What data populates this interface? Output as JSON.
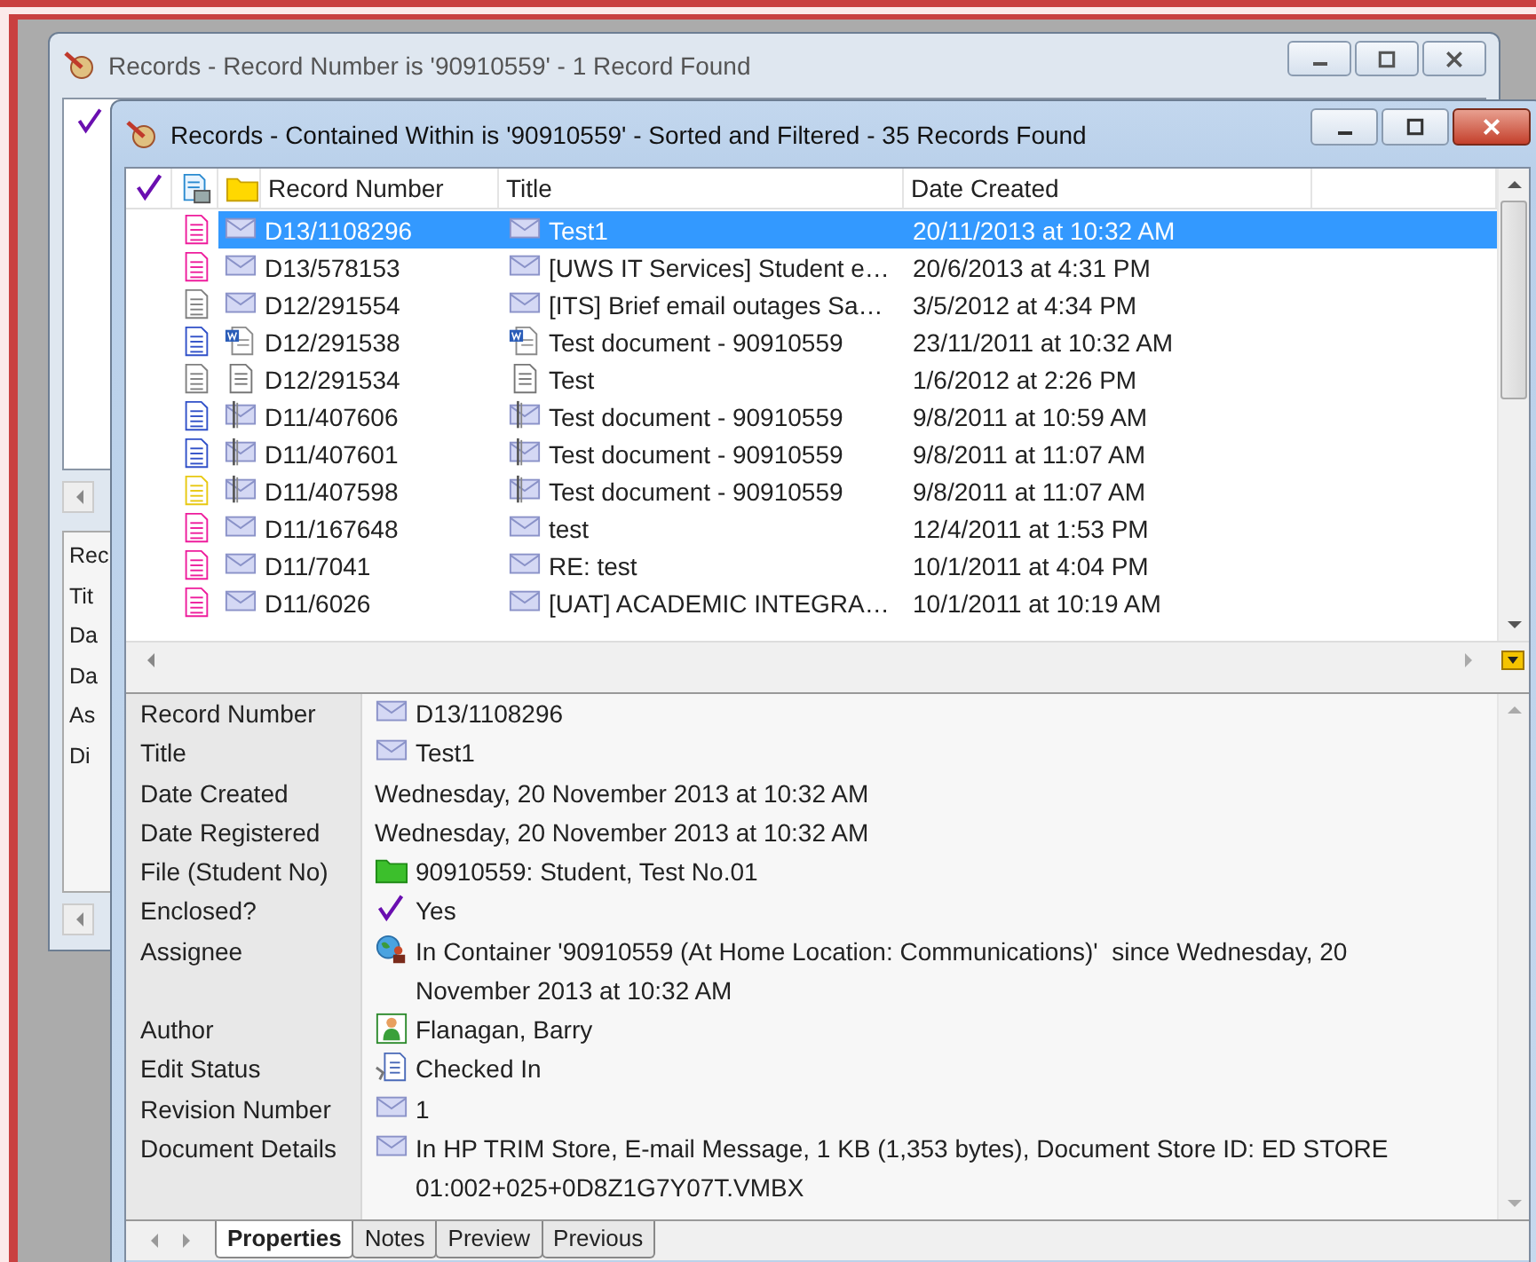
{
  "background_window": {
    "title": "Records - Record Number is '90910559' - 1 Record Found",
    "property_labels": [
      "Rec",
      "Tit",
      "Da",
      "Da",
      "As",
      "Di"
    ]
  },
  "window": {
    "title": "Records - Contained Within is '90910559' - Sorted and Filtered - 35 Records Found",
    "columns": [
      "Record Number",
      "Title",
      "Date Created"
    ],
    "rows": [
      {
        "color": "#ee1c9c",
        "kind": "email",
        "number": "D13/1108296",
        "title": "Test1",
        "date": "20/11/2013 at 10:32 AM",
        "selected": true
      },
      {
        "color": "#ee1c9c",
        "kind": "email",
        "number": "D13/578153",
        "title": "[UWS IT Services] Student e…",
        "date": "20/6/2013 at 4:31 PM",
        "selected": false
      },
      {
        "color": "#808080",
        "kind": "email",
        "number": "D12/291554",
        "title": "[ITS] Brief email outages Sa…",
        "date": "3/5/2012 at 4:34 PM",
        "selected": false
      },
      {
        "color": "#3050c8",
        "kind": "word",
        "number": "D12/291538",
        "title": "Test document - 90910559",
        "date": "23/11/2011 at 10:32 AM",
        "selected": false
      },
      {
        "color": "#808080",
        "kind": "text",
        "number": "D12/291534",
        "title": "Test",
        "date": "1/6/2012 at 2:26 PM",
        "selected": false
      },
      {
        "color": "#3050c8",
        "kind": "attachment",
        "number": "D11/407606",
        "title": "Test document - 90910559",
        "date": "9/8/2011 at 10:59 AM",
        "selected": false
      },
      {
        "color": "#3050c8",
        "kind": "attachment",
        "number": "D11/407601",
        "title": "Test document - 90910559",
        "date": "9/8/2011 at 11:07 AM",
        "selected": false
      },
      {
        "color": "#e8c810",
        "kind": "attachment",
        "number": "D11/407598",
        "title": "Test document - 90910559",
        "date": "9/8/2011 at 11:07 AM",
        "selected": false
      },
      {
        "color": "#ee1c9c",
        "kind": "email",
        "number": "D11/167648",
        "title": "test",
        "date": "12/4/2011 at 1:53 PM",
        "selected": false
      },
      {
        "color": "#ee1c9c",
        "kind": "email",
        "number": "D11/7041",
        "title": "RE: test",
        "date": "10/1/2011 at 4:04 PM",
        "selected": false
      },
      {
        "color": "#ee1c9c",
        "kind": "email",
        "number": "D11/6026",
        "title": "[UAT] ACADEMIC INTEGRA…",
        "date": "10/1/2011 at 10:19 AM",
        "selected": false
      }
    ],
    "properties": [
      {
        "label": "Record Number",
        "kind": "email",
        "lines": [
          "D13/1108296"
        ]
      },
      {
        "label": "Title",
        "kind": "email",
        "lines": [
          "Test1"
        ]
      },
      {
        "label": "Date Created",
        "kind": "none",
        "lines": [
          "Wednesday, 20 November 2013 at 10:32 AM"
        ]
      },
      {
        "label": "Date Registered",
        "kind": "none",
        "lines": [
          "Wednesday, 20 November 2013 at 10:32 AM"
        ]
      },
      {
        "label": "File (Student No)",
        "kind": "folder",
        "lines": [
          "90910559: Student, Test No.01"
        ]
      },
      {
        "label": "Enclosed?",
        "kind": "check",
        "lines": [
          "Yes"
        ]
      },
      {
        "label": "Assignee",
        "kind": "location",
        "lines": [
          "In Container '90910559 (At Home Location: Communications)'  since Wednesday, 20",
          "November 2013 at 10:32 AM"
        ]
      },
      {
        "label": "Author",
        "kind": "person",
        "lines": [
          "Flanagan, Barry"
        ]
      },
      {
        "label": "Edit Status",
        "kind": "checkin",
        "lines": [
          "Checked In"
        ]
      },
      {
        "label": "Revision Number",
        "kind": "email",
        "lines": [
          "1"
        ]
      },
      {
        "label": "Document Details",
        "kind": "email",
        "lines": [
          "In HP TRIM Store, E-mail Message, 1 KB (1,353 bytes), Document Store ID: ED STORE",
          "01:002+025+0D8Z1G7Y07T.VMBX"
        ]
      }
    ],
    "tabs": [
      {
        "label": "Properties",
        "selected": true
      },
      {
        "label": "Notes",
        "selected": false
      },
      {
        "label": "Preview",
        "selected": false
      },
      {
        "label": "Previous",
        "selected": false
      }
    ]
  }
}
